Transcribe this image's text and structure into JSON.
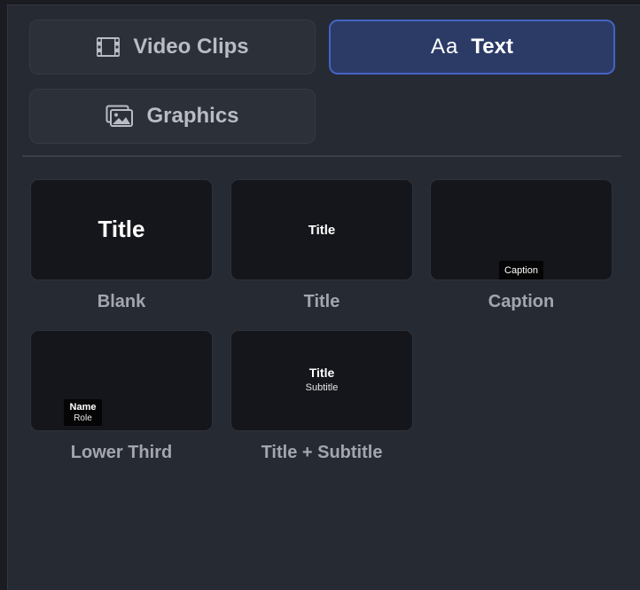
{
  "tabs": {
    "video_clips": {
      "label": "Video Clips",
      "icon": "film-icon"
    },
    "text": {
      "label": "Text",
      "prefix": "Aa",
      "icon": "text-aa-icon",
      "active": true
    },
    "graphics": {
      "label": "Graphics",
      "icon": "images-icon"
    }
  },
  "colors": {
    "panel_bg": "#262a33",
    "tab_bg": "#2c3039",
    "active_bg": "#2c3b66",
    "active_border": "#4363c4",
    "thumb_bg": "#15161b",
    "label_text": "#a3a6ad"
  },
  "templates": [
    {
      "name": "Blank",
      "preview": {
        "title": "Title"
      }
    },
    {
      "name": "Title",
      "preview": {
        "title": "Title"
      }
    },
    {
      "name": "Caption",
      "preview": {
        "caption": "Caption"
      }
    },
    {
      "name": "Lower Third",
      "preview": {
        "name": "Name",
        "role": "Role"
      }
    },
    {
      "name": "Title + Subtitle",
      "preview": {
        "title": "Title",
        "subtitle": "Subtitle"
      }
    }
  ]
}
